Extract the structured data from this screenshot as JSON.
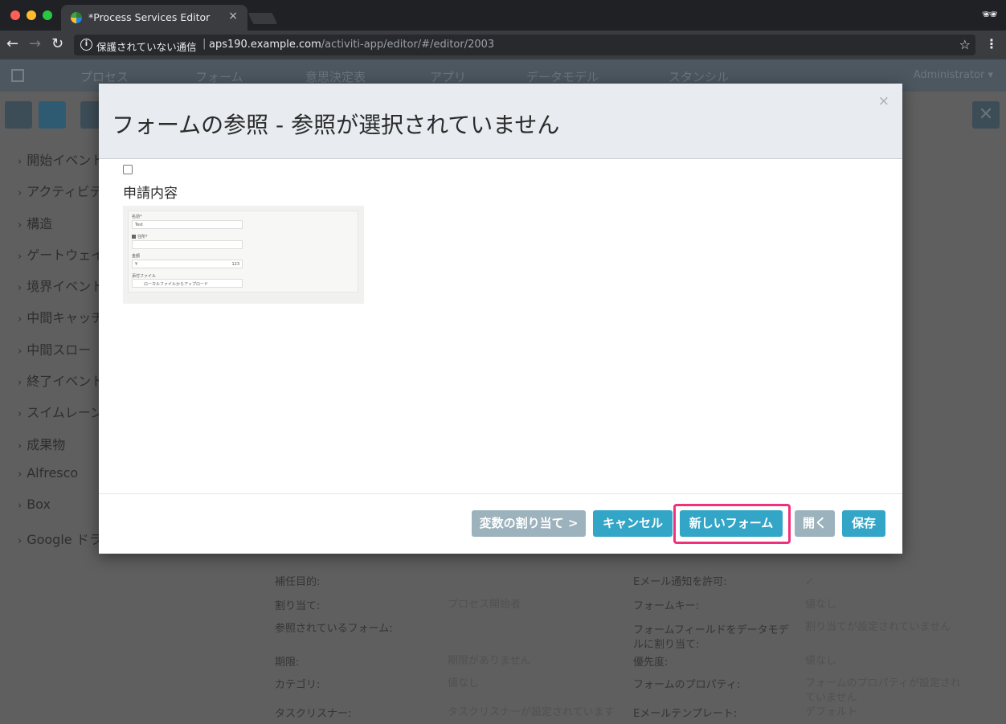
{
  "browser": {
    "tab_title": "*Process Services Editor",
    "tab_close": "×",
    "security_text": "保護されていない通信",
    "url_separator": "|",
    "url_host": "aps190.example.com",
    "url_path": "/activiti-app/editor/#/editor/2003",
    "back": "←",
    "forward": "→",
    "reload": "↻",
    "star": "☆",
    "menu": "⋮",
    "incognito": "🕶"
  },
  "app_nav": {
    "items": [
      "プロセス",
      "フォーム",
      "意思決定表",
      "アプリ",
      "データモデル",
      "スタンシル"
    ],
    "user": "Administrator ▾"
  },
  "palette": {
    "chevron": "›",
    "items": [
      "開始イベント",
      "アクティビティ",
      "構造",
      "ゲートウェイ",
      "境界イベント",
      "中間キャッチ",
      "中間スロー",
      "終了イベント",
      "スイムレーン",
      "成果物",
      "Alfresco",
      "Box",
      "Google ドライブ"
    ]
  },
  "properties": {
    "left_labels": [
      "補任目的:",
      "割り当て:",
      "参照されているフォーム:",
      "期限:",
      "カテゴリ:",
      "タスクリスナー:"
    ],
    "left_values": [
      "",
      "プロセス開始者",
      "",
      "期限がありません",
      "値なし",
      "タスクリスナーが設定されています"
    ],
    "right_labels": [
      "Eメール通知を許可:",
      "フォームキー:",
      "フォームフィールドをデータモデルに割り当て:",
      "優先度:",
      "フォームのプロパティ:",
      "Eメールテンプレート:"
    ],
    "right_values": [
      "✓",
      "値なし",
      "割り当てが設定されていません",
      "値なし",
      "フォームのプロパティが設定されていません",
      "デフォルト"
    ]
  },
  "modal": {
    "title": "フォームの参照 - 参照が選択されていません",
    "close": "×",
    "form_name": "申請内容",
    "thumbnail": {
      "field1_label": "名前*",
      "field1_value": "Test",
      "field2_label": "住所*",
      "field3_label": "金額",
      "field3_prefix": "¥",
      "field3_suffix": "123",
      "field4_label": "添付ファイル",
      "field4_value": "ローカルファイルからアップロード"
    },
    "buttons": {
      "assign": "変数の割り当て >",
      "cancel": "キャンセル",
      "new_form": "新しいフォーム",
      "open": "開く",
      "save": "保存"
    }
  },
  "colors": {
    "primary": "#33a6c7",
    "disabled": "#9cb2bc",
    "highlight": "#f0307a"
  }
}
